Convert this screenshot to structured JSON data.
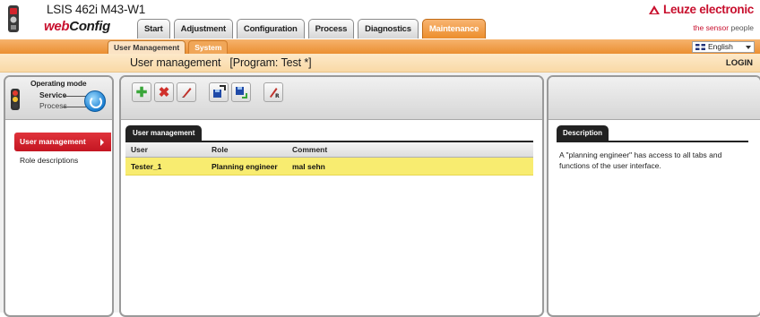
{
  "header": {
    "device_name": "LSIS 462i M43-W1",
    "app_logo_prefix": "web",
    "app_logo_suffix": "Config",
    "brand": "Leuze electronic",
    "tagline_red": "the sensor",
    "tagline_gray": " people"
  },
  "main_tabs": [
    {
      "label": "Start"
    },
    {
      "label": "Adjustment"
    },
    {
      "label": "Configuration"
    },
    {
      "label": "Process"
    },
    {
      "label": "Diagnostics"
    },
    {
      "label": "Maintenance",
      "active": true
    }
  ],
  "sub_tabs": [
    {
      "label": "User Management",
      "active": true
    },
    {
      "label": "System"
    }
  ],
  "language": {
    "selected": "English"
  },
  "title_bar": {
    "title": "User management",
    "program": "[Program: Test *]",
    "login": "LOGIN"
  },
  "operating_mode": {
    "label": "Operating mode",
    "service": "Service",
    "process": "Process"
  },
  "nav": {
    "items": [
      {
        "label": "User management",
        "active": true
      },
      {
        "label": "Role descriptions"
      }
    ]
  },
  "toolbar": {
    "icons": [
      "add-icon",
      "delete-icon",
      "edit-icon",
      "import-icon",
      "export-icon",
      "reset-icon"
    ]
  },
  "table": {
    "tab_label": "User management",
    "columns": [
      "User",
      "Role",
      "Comment"
    ],
    "rows": [
      {
        "user": "Tester_1",
        "role": "Planning engineer",
        "comment": "mal sehn"
      }
    ]
  },
  "description": {
    "tab_label": "Description",
    "text": "A \"planning engineer\" has access to all tabs and functions of the user interface."
  },
  "colors": {
    "accent_orange": "#eb8f32",
    "brand_red": "#c8102e",
    "selected_row": "#f8ec70"
  }
}
